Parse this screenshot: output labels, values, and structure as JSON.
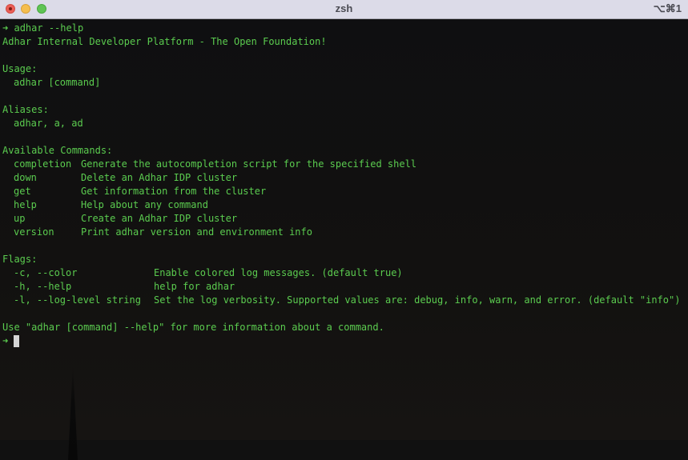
{
  "window": {
    "title": "zsh",
    "shortcut": "⌥⌘1"
  },
  "terminal": {
    "prompt_symbol": "➜",
    "command": "adhar --help",
    "description": "Adhar Internal Developer Platform - The Open Foundation!",
    "usage_header": "Usage:",
    "usage": "adhar [command]",
    "aliases_header": "Aliases:",
    "aliases": "adhar, a, ad",
    "commands_header": "Available Commands:",
    "commands": [
      {
        "name": "completion",
        "desc": "Generate the autocompletion script for the specified shell"
      },
      {
        "name": "down",
        "desc": "Delete an Adhar IDP cluster"
      },
      {
        "name": "get",
        "desc": "Get information from the cluster"
      },
      {
        "name": "help",
        "desc": "Help about any command"
      },
      {
        "name": "up",
        "desc": "Create an Adhar IDP cluster"
      },
      {
        "name": "version",
        "desc": "Print adhar version and environment info"
      }
    ],
    "flags_header": "Flags:",
    "flags": [
      {
        "name": "-c, --color",
        "desc": "Enable colored log messages. (default true)"
      },
      {
        "name": "-h, --help",
        "desc": "help for adhar"
      },
      {
        "name": "-l, --log-level string",
        "desc": "Set the log verbosity. Supported values are: debug, info, warn, and error. (default \"info\")"
      }
    ],
    "footer": "Use \"adhar [command] --help\" for more information about a command.",
    "colors": {
      "text": "#5bcc4f",
      "background": "#111111",
      "cursor": "#d4d4d4"
    }
  }
}
